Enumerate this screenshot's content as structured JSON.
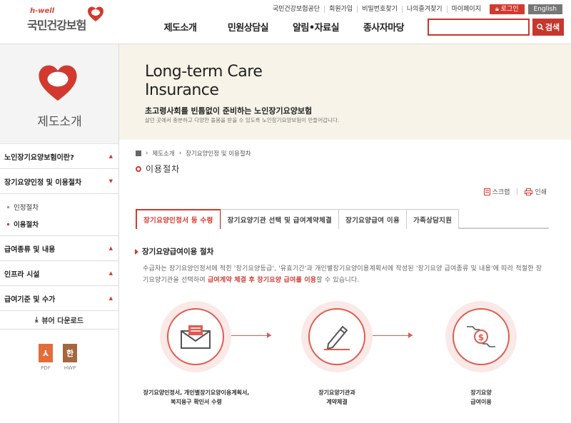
{
  "header": {
    "logo_tagline": "h-well",
    "logo_name": "국민건강보험",
    "util_links": [
      "국민건강보험공단",
      "회원가입",
      "비밀번호찾기",
      "나의즐겨찾기",
      "마이페이지"
    ],
    "login_label": "로그인",
    "english_label": "English",
    "gnb": [
      "제도소개",
      "민원상담실",
      "알림•자료실",
      "종사자마당"
    ],
    "search_value": "",
    "search_button": "검색"
  },
  "sidebar": {
    "title": "제도소개",
    "menu": [
      {
        "label": "노인장기요양보험이란?",
        "expanded": false
      },
      {
        "label": "장기요양인정 및 이용절차",
        "expanded": true,
        "sub": [
          {
            "label": "인정절차",
            "active": false
          },
          {
            "label": "이용절차",
            "active": true
          }
        ]
      },
      {
        "label": "급여종류 및 내용",
        "expanded": false
      },
      {
        "label": "인프라 시설",
        "expanded": false
      },
      {
        "label": "급여기준 및 수가",
        "expanded": false
      }
    ],
    "download_label": "뷰어 다운로드",
    "viewers": [
      {
        "label": "PDF",
        "glyph": "⅄",
        "color": "#e36d3a"
      },
      {
        "label": "HWP",
        "glyph": "한",
        "color": "#a5673f"
      }
    ]
  },
  "banner": {
    "title_line1": "Long-term Care",
    "title_line2": "Insurance",
    "subtitle": "초고령사회를 빈틈없이 준비하는 노인장기요양보험",
    "description": "살던 곳에서 충분하고 다양한 돌봄을 받을 수 있도록 노인장기요양보험이 만들어갑니다."
  },
  "breadcrumb": [
    "제도소개",
    "장기요양인정 및 이용절차"
  ],
  "page_title": "이용절차",
  "tools": {
    "scrap": "스크랩",
    "print": "인쇄"
  },
  "tabs": [
    {
      "label": "장기요양인정서 등 수령",
      "active": true
    },
    {
      "label": "장기요양기관 선택 및 급여계약체결",
      "active": false
    },
    {
      "label": "장기요양급여 이용",
      "active": false
    },
    {
      "label": "가족상담지원",
      "active": false
    }
  ],
  "section": {
    "title": "장기요양급여이용 절차",
    "desc_part1": "수급자는 장기요양인정서에 적힌 '장기요양등급', '유효기간'과 개인별장기요양이용계획서에 작성된 '장기요양 급여종류 및 내용'에 따라 적절한 장기요양기관을 선택하여 ",
    "desc_highlight": "급여계약 체결 후 장기요양 급여를 이용",
    "desc_part2": "할 수 있습니다."
  },
  "flow_steps": [
    {
      "icon": "envelope-icon",
      "label_line1": "장기요양인정서, 개인별장기요양이용계획서,",
      "label_line2": "복지용구 확인서 수령"
    },
    {
      "icon": "pen-sign-icon",
      "label_line1": "장기요양기관과",
      "label_line2": "계약체결"
    },
    {
      "icon": "money-hand-icon",
      "label_line1": "장기요양",
      "label_line2": "급여이용"
    }
  ],
  "colors": {
    "accent": "#d23a2f",
    "circle_bg": "#fbe9e7",
    "banner_bg": "#f7f3e8"
  }
}
